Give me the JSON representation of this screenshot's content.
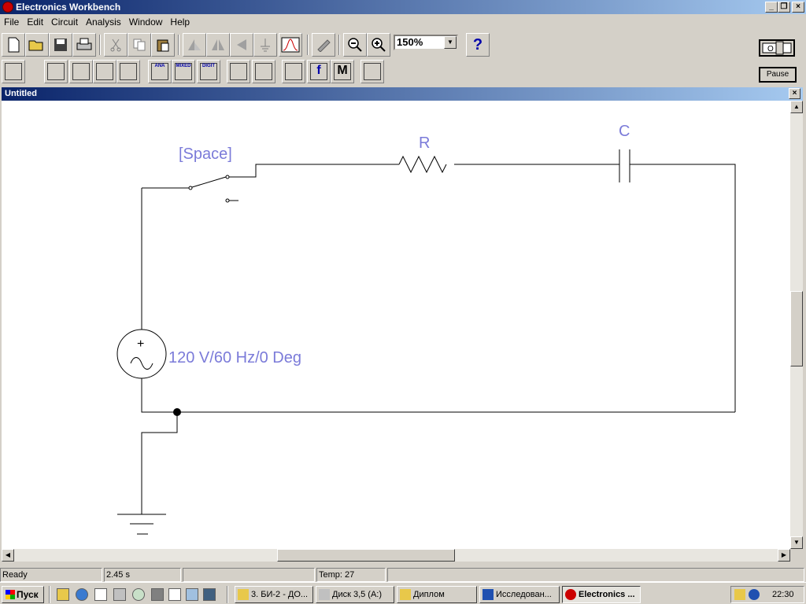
{
  "window": {
    "title": "Electronics Workbench"
  },
  "menu": [
    "File",
    "Edit",
    "Circuit",
    "Analysis",
    "Window",
    "Help"
  ],
  "toolbar1": {
    "buttons": [
      "new-icon",
      "open-icon",
      "save-icon",
      "print-icon",
      "cut-icon",
      "copy-icon",
      "paste-icon",
      "rotate-icon",
      "flip-horizontal-icon",
      "flip-vertical-icon",
      "subcircuit-icon",
      "graph-icon",
      "component-properties-icon",
      "zoom-out-icon",
      "zoom-in-icon"
    ],
    "zoom": "150%",
    "help": "?"
  },
  "toolbar2": {
    "bins": [
      {
        "name": "favorites-bin",
        "label": ""
      },
      {
        "name": "sources-bin",
        "label": ""
      },
      {
        "name": "basic-bin",
        "label": ""
      },
      {
        "name": "diodes-bin",
        "label": ""
      },
      {
        "name": "transistors-bin",
        "label": ""
      },
      {
        "name": "analog-ics-bin",
        "label": "ANA"
      },
      {
        "name": "mixed-ics-bin",
        "label": "MIXED"
      },
      {
        "name": "digital-ics-bin",
        "label": "DIGIT"
      },
      {
        "name": "logic-gates-bin",
        "label": ""
      },
      {
        "name": "digital-bin",
        "label": ""
      },
      {
        "name": "indicators-bin",
        "label": ""
      },
      {
        "name": "controls-bin",
        "label": "f"
      },
      {
        "name": "miscellaneous-bin",
        "label": "M"
      },
      {
        "name": "instruments-bin",
        "label": ""
      }
    ],
    "power_switch": "O",
    "pause": "Pause"
  },
  "document": {
    "title": "Untitled"
  },
  "circuit": {
    "switch_label": "[Space]",
    "resistor_label": "R",
    "capacitor_label": "C",
    "source_label": "120 V/60 Hz/0 Deg",
    "source_symbol": "+"
  },
  "status": {
    "state": "Ready",
    "time": "2.45 s",
    "temp": "Temp:  27"
  },
  "taskbar": {
    "start": "Пуск",
    "tasks": [
      "3. БИ-2 - ДО...",
      "Диск 3,5 (A:)",
      "Диплом",
      "Исследован...",
      "Electronics ..."
    ],
    "clock": "22:30"
  },
  "colors": {
    "title_start": "#0a246a",
    "title_end": "#a6caf0",
    "label_color": "#7b7bd9"
  }
}
